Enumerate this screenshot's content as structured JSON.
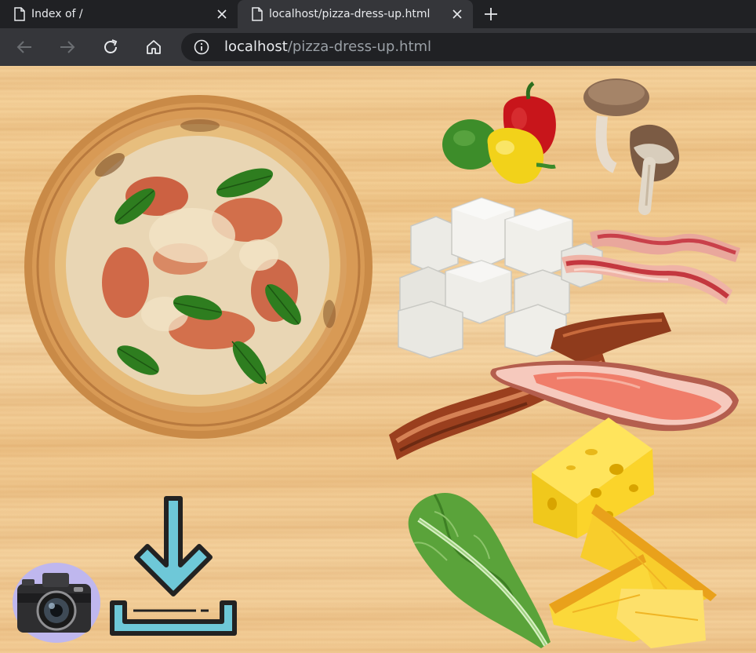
{
  "browser": {
    "tabs": [
      {
        "title": "Index of /",
        "active": false
      },
      {
        "title": "localhost/pizza-dress-up.html",
        "active": true
      }
    ],
    "address": {
      "host": "localhost",
      "path": "/pizza-dress-up.html"
    }
  },
  "colors": {
    "chrome_dark": "#202124",
    "chrome_toolbar": "#35363a",
    "chrome_text": "#e8eaed",
    "chrome_muted": "#9aa0a6",
    "download_accent": "#6ec8d8"
  },
  "page": {
    "pizza": "margherita-pizza",
    "toppings": [
      "bell-peppers",
      "mushrooms",
      "feta-cheese",
      "bacon",
      "cooked-bacon",
      "ham",
      "swiss-cheese",
      "lettuce",
      "pineapple"
    ],
    "controls": [
      "camera-button",
      "download-button"
    ]
  }
}
